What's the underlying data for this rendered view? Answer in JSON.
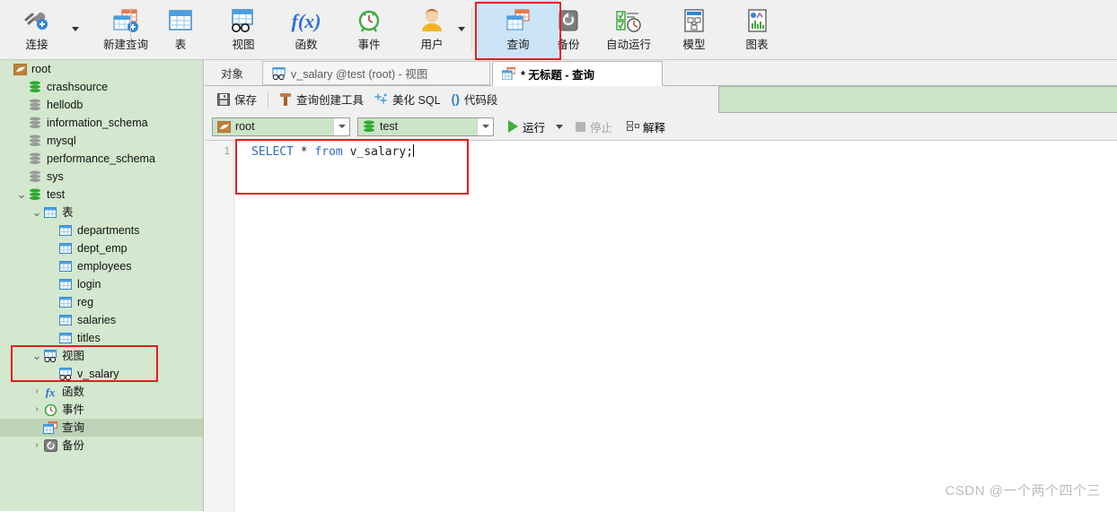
{
  "ribbon": {
    "items": [
      {
        "label": "连接",
        "icon": "connection-plus-icon",
        "has_caret": true,
        "selected": false
      },
      {
        "label": "新建查询",
        "icon": "new-query-icon",
        "has_caret": false,
        "selected": false
      },
      {
        "label": "表",
        "icon": "table-icon",
        "has_caret": false,
        "selected": false
      },
      {
        "label": "视图",
        "icon": "view-icon",
        "has_caret": false,
        "selected": false
      },
      {
        "label": "函数",
        "icon": "function-fx-icon",
        "has_caret": false,
        "selected": false
      },
      {
        "label": "事件",
        "icon": "event-clock-icon",
        "has_caret": false,
        "selected": false
      },
      {
        "label": "用户",
        "icon": "user-icon",
        "has_caret": true,
        "selected": false
      },
      {
        "label": "查询",
        "icon": "query-icon",
        "has_caret": false,
        "selected": true
      },
      {
        "label": "备份",
        "icon": "backup-icon",
        "has_caret": false,
        "selected": false
      },
      {
        "label": "自动运行",
        "icon": "automation-icon",
        "has_caret": false,
        "selected": false
      },
      {
        "label": "模型",
        "icon": "model-icon",
        "has_caret": false,
        "selected": false
      },
      {
        "label": "图表",
        "icon": "chart-icon",
        "has_caret": false,
        "selected": false
      }
    ]
  },
  "sidebar": {
    "nodes": [
      {
        "label": "root",
        "icon": "connection-icon",
        "indent": 0,
        "twisty": "",
        "selected": false
      },
      {
        "label": "crashsource",
        "icon": "db-green-icon",
        "indent": 1,
        "twisty": "",
        "selected": false
      },
      {
        "label": "hellodb",
        "icon": "db-gray-icon",
        "indent": 1,
        "twisty": "",
        "selected": false
      },
      {
        "label": "information_schema",
        "icon": "db-gray-icon",
        "indent": 1,
        "twisty": "",
        "selected": false
      },
      {
        "label": "mysql",
        "icon": "db-gray-icon",
        "indent": 1,
        "twisty": "",
        "selected": false
      },
      {
        "label": "performance_schema",
        "icon": "db-gray-icon",
        "indent": 1,
        "twisty": "",
        "selected": false
      },
      {
        "label": "sys",
        "icon": "db-gray-icon",
        "indent": 1,
        "twisty": "",
        "selected": false
      },
      {
        "label": "test",
        "icon": "db-green-icon",
        "indent": 1,
        "twisty": "expanded",
        "selected": false
      },
      {
        "label": "表",
        "icon": "table-icon",
        "indent": 2,
        "twisty": "expanded",
        "selected": false
      },
      {
        "label": "departments",
        "icon": "table-icon",
        "indent": 3,
        "twisty": "",
        "selected": false
      },
      {
        "label": "dept_emp",
        "icon": "table-icon",
        "indent": 3,
        "twisty": "",
        "selected": false
      },
      {
        "label": "employees",
        "icon": "table-icon",
        "indent": 3,
        "twisty": "",
        "selected": false
      },
      {
        "label": "login",
        "icon": "table-icon",
        "indent": 3,
        "twisty": "",
        "selected": false
      },
      {
        "label": "reg",
        "icon": "table-icon",
        "indent": 3,
        "twisty": "",
        "selected": false
      },
      {
        "label": "salaries",
        "icon": "table-icon",
        "indent": 3,
        "twisty": "",
        "selected": false
      },
      {
        "label": "titles",
        "icon": "table-icon",
        "indent": 3,
        "twisty": "",
        "selected": false
      },
      {
        "label": "视图",
        "icon": "view-icon",
        "indent": 2,
        "twisty": "expanded",
        "selected": false
      },
      {
        "label": "v_salary",
        "icon": "view-icon",
        "indent": 3,
        "twisty": "",
        "selected": false
      },
      {
        "label": "函数",
        "icon": "function-fx-icon",
        "indent": 2,
        "twisty": "collapsed",
        "selected": false
      },
      {
        "label": "事件",
        "icon": "event-clock-icon",
        "indent": 2,
        "twisty": "collapsed",
        "selected": false
      },
      {
        "label": "查询",
        "icon": "query-icon",
        "indent": 2,
        "twisty": "",
        "selected": true
      },
      {
        "label": "备份",
        "icon": "backup-icon",
        "indent": 2,
        "twisty": "collapsed",
        "selected": false
      }
    ]
  },
  "tabs": {
    "object_label": "对象",
    "items": [
      {
        "label": "v_salary @test (root) - 视图",
        "icon": "view-icon",
        "active": false
      },
      {
        "label": "* 无标题 - 查询",
        "icon": "query-icon",
        "active": true
      }
    ]
  },
  "query_toolbar": {
    "save_label": "保存",
    "builder_label": "查询创建工具",
    "beautify_label": "美化 SQL",
    "snippet_label": "代码段"
  },
  "selectors": {
    "connection_value": "root",
    "database_value": "test",
    "run_label": "运行",
    "stop_label": "停止",
    "explain_label": "解释"
  },
  "editor": {
    "line_number": "1",
    "sql_keyword_1": "SELECT",
    "sql_star": " * ",
    "sql_keyword_2": "from",
    "sql_rest": " v_salary;"
  },
  "watermark": {
    "text": "CSDN @一个两个四个三"
  },
  "colors": {
    "sidebar_bg": "#d3e8cf",
    "selection": "#bcd3b7",
    "ribbon_selected": "#cce4f7",
    "annotation": "#e81c1c",
    "combo_bg": "#cbe5c7",
    "keyword": "#2b6cc4"
  }
}
